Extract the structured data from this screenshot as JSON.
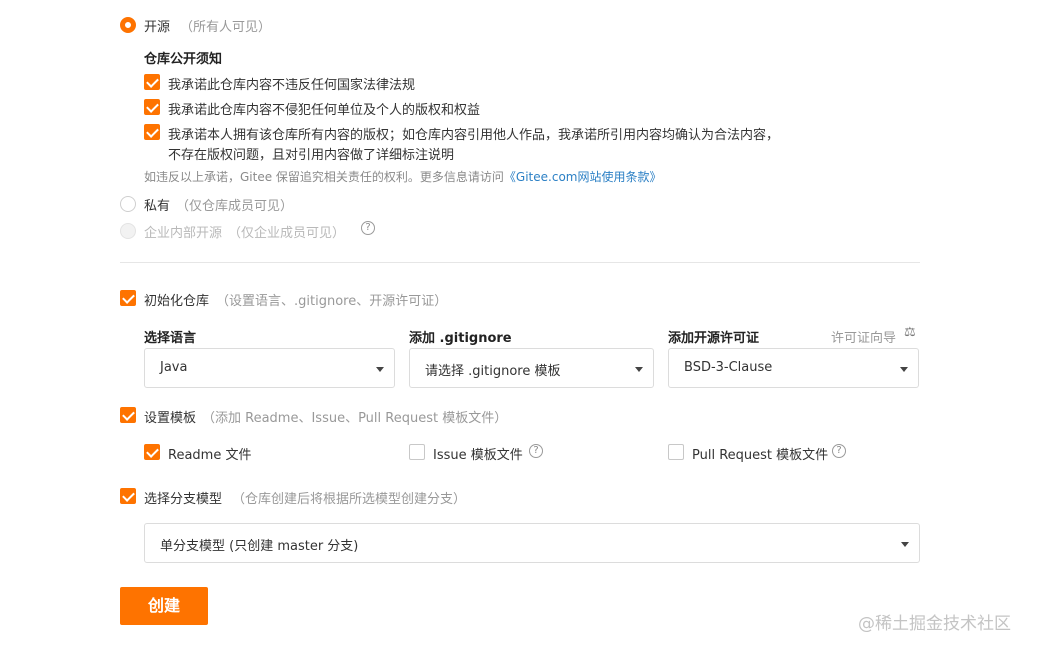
{
  "visibility": {
    "open": {
      "label": "开源",
      "hint": "（所有人可见）"
    },
    "notice": {
      "title": "仓库公开须知",
      "items": [
        "我承诺此仓库内容不违反任何国家法律法规",
        "我承诺此仓库内容不侵犯任何单位及个人的版权和权益",
        "我承诺本人拥有该仓库所有内容的版权；如仓库内容引用他人作品，我承诺所引用内容均确认为合法内容，",
        "不存在版权问题，且对引用内容做了详细标注说明"
      ],
      "footer": "如违反以上承诺，Gitee 保留追究相关责任的权利。更多信息请访问",
      "footer_link": "《Gitee.com网站使用条款》"
    },
    "private": {
      "label": "私有",
      "hint": "（仅仓库成员可见）"
    },
    "enterprise": {
      "label": "企业内部开源",
      "hint": "（仅企业成员可见）"
    }
  },
  "init_repo": {
    "label": "初始化仓库",
    "hint": "（设置语言、.gitignore、开源许可证）",
    "language": {
      "label": "选择语言",
      "value": "Java"
    },
    "gitignore": {
      "label": "添加 .gitignore",
      "value": "请选择 .gitignore 模板"
    },
    "license": {
      "label": "添加开源许可证",
      "guide": "许可证向导",
      "value": "BSD-3-Clause"
    }
  },
  "template": {
    "label": "设置模板",
    "hint": "（添加 Readme、Issue、Pull Request 模板文件）",
    "readme": "Readme 文件",
    "issue": "Issue 模板文件",
    "pr": "Pull Request 模板文件"
  },
  "branch": {
    "label": "选择分支模型",
    "hint": "（仓库创建后将根据所选模型创建分支）",
    "value": "单分支模型 (只创建 master 分支)"
  },
  "create_label": "创建",
  "watermark": "@稀土掘金技术社区",
  "colors": {
    "accent": "#fe7300",
    "link": "#2c80c5"
  }
}
